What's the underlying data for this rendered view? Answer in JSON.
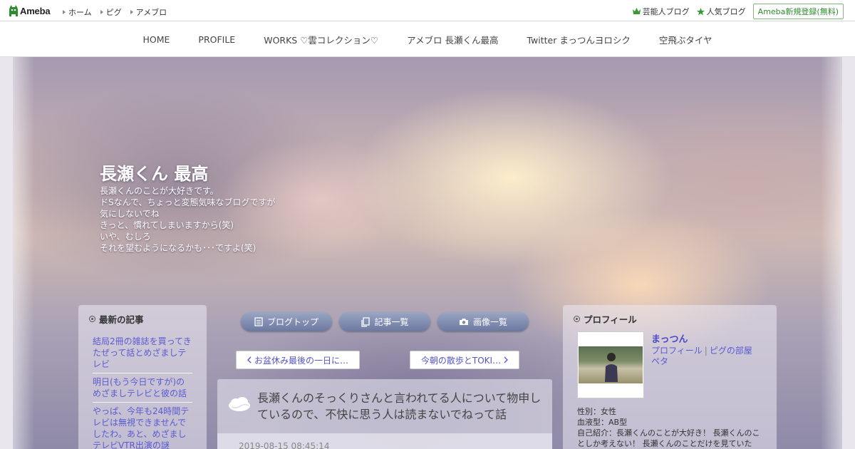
{
  "topbar": {
    "logo_text": "Ameba",
    "links": [
      "ホーム",
      "ピグ",
      "アメブロ"
    ],
    "right_links": [
      "芸能人ブログ",
      "人気ブログ"
    ],
    "register_label": "Ameba新規登録(無料)"
  },
  "nav": {
    "items": [
      "HOME",
      "PROFILE",
      "WORKS ♡雲コレクション♡",
      "アメブロ 長瀬くん最高",
      "Twitter まっつんヨロシク",
      "空飛ぶタイヤ"
    ]
  },
  "header": {
    "title": "長瀬くん 最高",
    "description": [
      "長瀬くんのことが大好きです。",
      "ドSなんで、ちょっと変態気味なブログですが",
      "気にしないでね",
      "きっと、慣れてしまいますから(笑)",
      "いや、むしろ",
      "それを望むようになるかも･･･ですよ(笑)"
    ]
  },
  "sidebar_left": {
    "heading": "最新の記事",
    "items": [
      "結局2冊の雑誌を買ってきたぜって話とめざましテレビ",
      "明日(もう今日ですが)のめざましテレビと彼の話",
      "やっぱ、今年も24時間テレビは無視できませんでしたわ。あと、めざましテレビVTR出演の謎"
    ]
  },
  "buttons": {
    "blog_top": "ブログトップ",
    "article_list": "記事一覧",
    "image_list": "画像一覧"
  },
  "pager": {
    "prev": "お盆休み最後の一日に…",
    "next": "今朝の散歩とTOKI…"
  },
  "article": {
    "title": "長瀬くんのそっくりさんと言われてる人について物申しているので、不快に思う人は読まないでねって話",
    "date": "2019-08-15 08:45:14"
  },
  "sidebar_right": {
    "heading": "プロフィール",
    "name": "まっつん",
    "link_profile": "プロフィール",
    "link_pig": "ピグの部屋",
    "link_peta": "ペタ",
    "gender": "性別：女性",
    "blood": "血液型：AB型",
    "intro": "自己紹介：長瀬くんのことが大好き！ 長瀬くんのことしか考えない！ 長瀬くんのことだけを見ていた"
  },
  "colors": {
    "accent_green": "#2e8b2e",
    "link_blue": "#5a5ad0",
    "pill_blue": "#7b87ac"
  }
}
